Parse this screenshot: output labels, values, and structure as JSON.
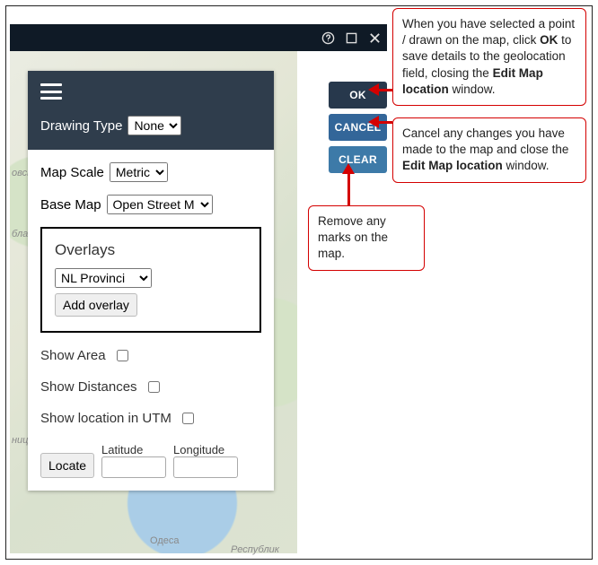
{
  "titlebar": {
    "help_icon": "help-circle-icon",
    "window_icon": "window-square-icon",
    "close_icon": "close-x-icon"
  },
  "buttons": {
    "ok": "OK",
    "cancel": "CANCEL",
    "clear": "CLEAR"
  },
  "panel": {
    "drawing_type_label": "Drawing Type",
    "drawing_type_value": "None",
    "map_scale_label": "Map Scale",
    "map_scale_value": "Metric",
    "base_map_label": "Base Map",
    "base_map_value": "Open Street M",
    "overlays_heading": "Overlays",
    "overlays_value": "NL Provinci",
    "add_overlay_label": "Add overlay",
    "show_area_label": "Show Area",
    "show_distances_label": "Show Distances",
    "show_utm_label": "Show location in UTM",
    "locate_label": "Locate",
    "latitude_label": "Latitude",
    "longitude_label": "Longitude"
  },
  "callouts": {
    "ok_text_1": "When you have selected a point / drawn on the map, click ",
    "ok_bold_1": "OK",
    "ok_text_2": " to save details to the geolocation field, closing the ",
    "ok_bold_2": "Edit Map location",
    "ok_text_3": " window.",
    "cancel_text_1": "Cancel any changes you have made to the map and close the ",
    "cancel_bold": "Edit Map location",
    "cancel_text_2": " window.",
    "clear_text": "Remove any marks on the map."
  },
  "map_labels": {
    "a": "овська",
    "b": "бласть",
    "c": "ницька",
    "d": "Одеса",
    "e": "Республик"
  }
}
